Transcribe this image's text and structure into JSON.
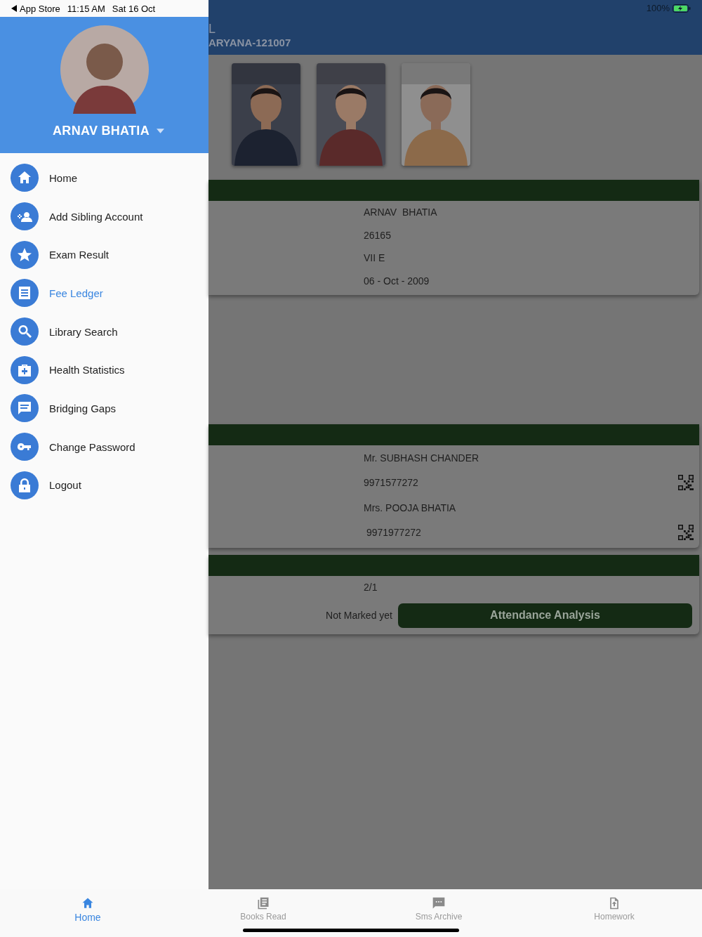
{
  "status_bar": {
    "back_app": "App Store",
    "time": "11:15 AM",
    "date": "Sat 16 Oct",
    "battery": "100%"
  },
  "header": {
    "title_fragment": "L",
    "subtitle_fragment": "ARYANA-121007"
  },
  "drawer": {
    "name": "ARNAV BHATIA",
    "items": [
      {
        "label": "Home",
        "selected": false
      },
      {
        "label": "Add Sibling Account",
        "selected": false
      },
      {
        "label": "Exam Result",
        "selected": false
      },
      {
        "label": "Fee Ledger",
        "selected": true
      },
      {
        "label": "Library Search",
        "selected": false
      },
      {
        "label": "Health Statistics",
        "selected": false
      },
      {
        "label": "Bridging Gaps",
        "selected": false
      },
      {
        "label": "Change Password",
        "selected": false
      },
      {
        "label": "Logout",
        "selected": false
      }
    ]
  },
  "student_card": {
    "rows": [
      "ARNAV  BHATIA",
      "26165",
      "VII E",
      "06 - Oct - 2009"
    ]
  },
  "parents_card": {
    "rows": [
      {
        "kind": "name",
        "text": "Mr. SUBHASH CHANDER"
      },
      {
        "kind": "phone",
        "text": "9971577272"
      },
      {
        "kind": "name",
        "text": "Mrs. POOJA BHATIA"
      },
      {
        "kind": "phone",
        "text": " 9971977272"
      }
    ]
  },
  "attendance_card": {
    "value": "2/1",
    "status": "Not Marked yet",
    "button": "Attendance Analysis"
  },
  "bottom_nav": [
    {
      "label": "Home",
      "selected": true
    },
    {
      "label": "Books Read",
      "selected": false
    },
    {
      "label": "Sms Archive",
      "selected": false
    },
    {
      "label": "Homework",
      "selected": false
    }
  ]
}
